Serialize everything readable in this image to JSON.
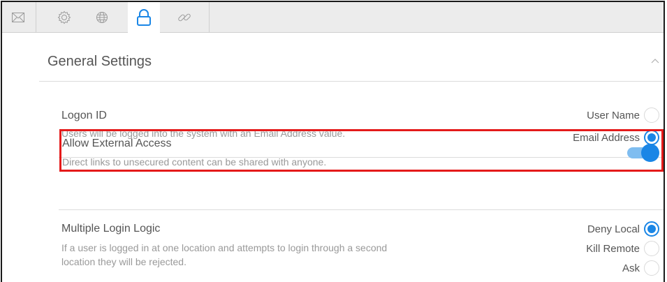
{
  "tabs": [
    {
      "icon": "mail-icon",
      "active": false
    },
    {
      "icon": "gear-icon",
      "active": false
    },
    {
      "icon": "globe-icon",
      "active": false
    },
    {
      "icon": "lock-icon",
      "active": true
    },
    {
      "icon": "link-icon",
      "active": false
    }
  ],
  "section": {
    "title": "General Settings",
    "expanded": true
  },
  "settings": {
    "logon": {
      "title": "Logon ID",
      "description": "Users will be logged into the system with an Email Address value.",
      "options": [
        "User Name",
        "Email Address"
      ],
      "selected": "Email Address"
    },
    "external": {
      "title": "Allow External Access",
      "description": "Direct links to unsecured content can be shared with anyone.",
      "enabled": true
    },
    "multi": {
      "title": "Multiple Login Logic",
      "description_line1": "If a user is logged in at one location and attempts to login through a second",
      "description_line2": "location they will be rejected.",
      "options": [
        "Deny Local",
        "Kill Remote",
        "Ask"
      ],
      "selected": "Deny Local"
    }
  },
  "colors": {
    "accent": "#1a86e6",
    "highlight_border": "#e41a1a"
  }
}
